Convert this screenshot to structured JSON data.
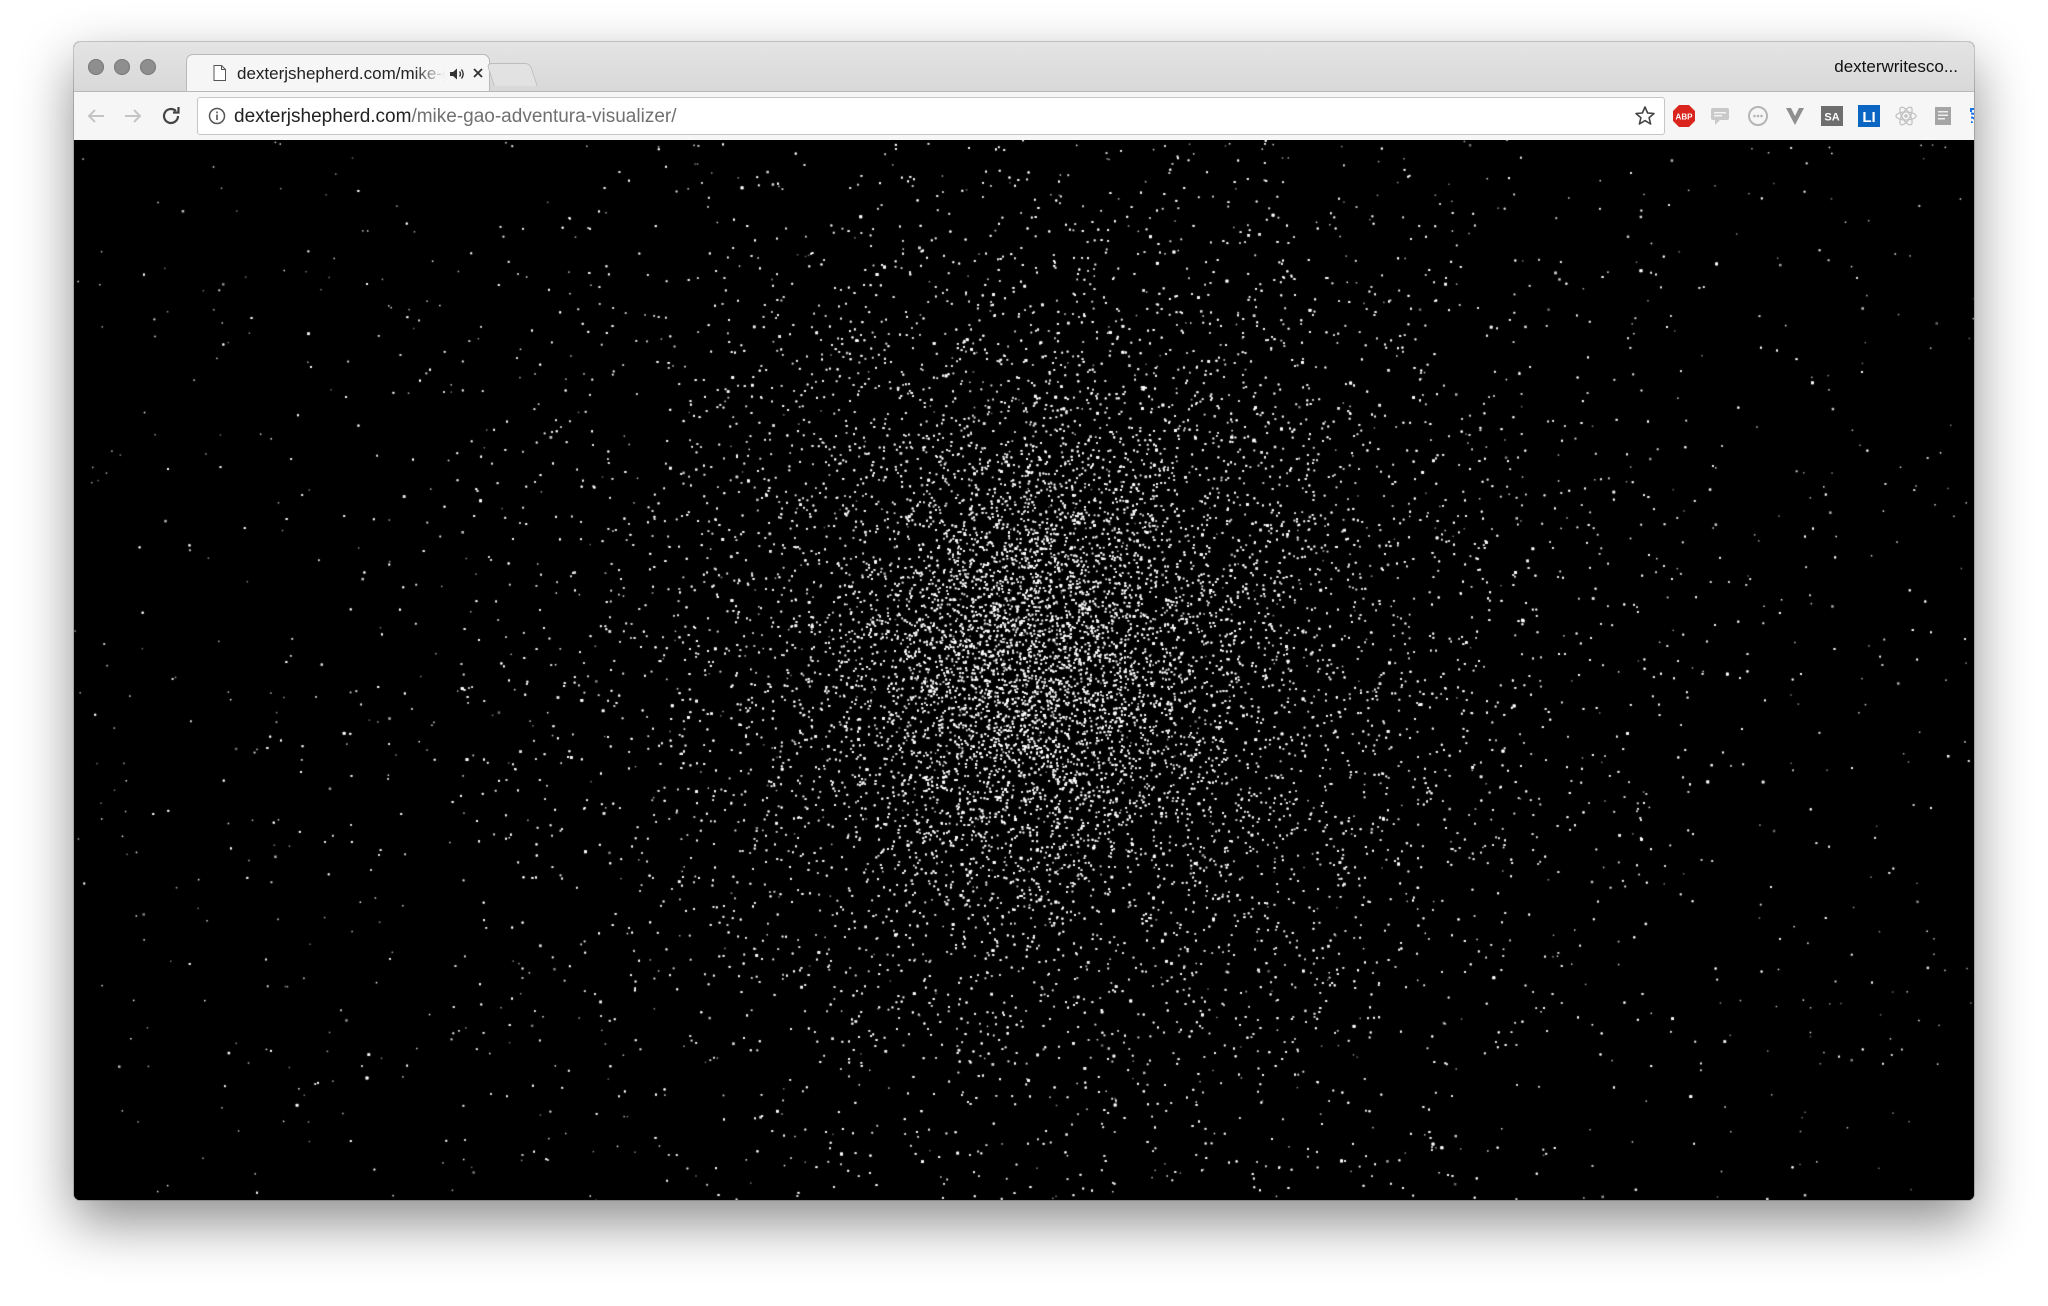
{
  "browser": {
    "tab": {
      "title": "dexterjshepherd.com/mike-gao-adventura-visualizer/"
    },
    "profile_name": "dexterwritesco...",
    "address_bar": {
      "host": "dexterjshepherd.com",
      "path": "/mike-gao-adventura-visualizer/"
    },
    "extensions": [
      {
        "name": "adblock-plus",
        "label": "ABP",
        "color": "#d9251d"
      },
      {
        "name": "chat-extension",
        "label": "",
        "color": "#b8b8b8"
      },
      {
        "name": "circle-extension",
        "label": "",
        "color": "#b8b8b8"
      },
      {
        "name": "vimium",
        "label": "V",
        "color": "#8a8a8a"
      },
      {
        "name": "sa-extension",
        "label": "SA",
        "color": "#6e6e6e"
      },
      {
        "name": "linkedin",
        "label": "LI",
        "color": "#0a66c2"
      },
      {
        "name": "react-devtools",
        "label": "",
        "color": "#c2c2c2"
      },
      {
        "name": "reader-extension",
        "label": "",
        "color": "#a0a0a0"
      },
      {
        "name": "cast",
        "label": "",
        "color": "#1a73e8"
      }
    ]
  },
  "visualizer": {
    "background": "#000000",
    "particle_color": "#ffffff"
  }
}
